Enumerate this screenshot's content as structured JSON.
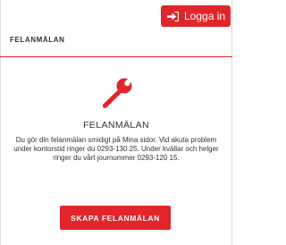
{
  "header": {
    "login_label": "Logga in",
    "login_icon": "sign-in-icon"
  },
  "page": {
    "title": "FELANMÄLAN"
  },
  "main": {
    "icon": "wrench-icon",
    "subtitle": "FELANMÄLAN",
    "description": "Du gör din felanmälan smidigt på Mina sidor. Vid akuta problem under kontorstid ringer du 0293-130 25. Under kvällar och helger ringer du vårt journummer 0293-120 15.",
    "cta_label": "SKAPA FELANMÄLAN"
  },
  "colors": {
    "accent": "#e0262a",
    "text": "#333333"
  }
}
